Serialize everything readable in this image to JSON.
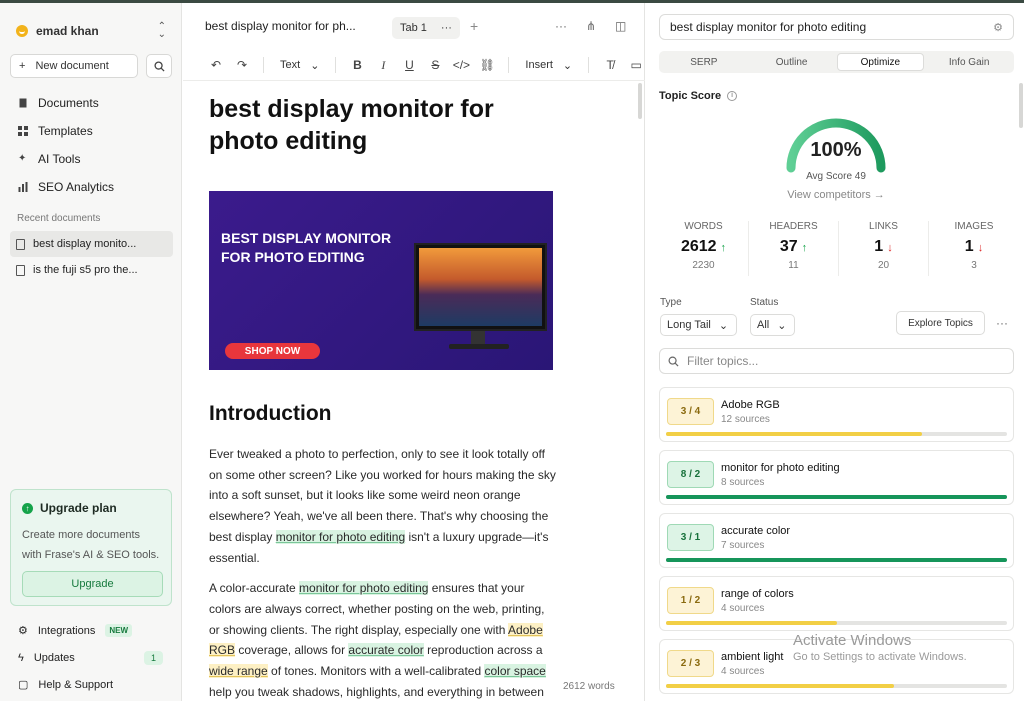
{
  "sidebar": {
    "user": "emad khan",
    "new_doc": "New document",
    "nav": [
      {
        "label": "Documents",
        "icon": "file-icon"
      },
      {
        "label": "Templates",
        "icon": "grid-icon"
      },
      {
        "label": "AI Tools",
        "icon": "sparkle-icon"
      },
      {
        "label": "SEO Analytics",
        "icon": "chart-icon"
      }
    ],
    "recent_heading": "Recent documents",
    "recent": [
      "best display monito...",
      "is the fuji s5 pro the..."
    ],
    "upgrade": {
      "title": "Upgrade plan",
      "desc": "Create more documents with Frase's AI & SEO tools.",
      "button": "Upgrade"
    },
    "bottom": {
      "integrations": "Integrations",
      "new_badge": "NEW",
      "updates": "Updates",
      "updates_count": "1",
      "help": "Help & Support"
    }
  },
  "editor": {
    "doc_title": "best display monitor for ph...",
    "tab": "Tab 1",
    "toolbar": {
      "text": "Text",
      "insert": "Insert"
    },
    "h1": "best display monitor for photo editing",
    "hero": {
      "text": "BEST DISPLAY MONITOR FOR PHOTO EDITING",
      "cta": "SHOP NOW"
    },
    "h2": "Introduction",
    "p1": {
      "a": "Ever tweaked a photo to perfection, only to see it look totally off on some other screen? Like you worked for hours making the sky into a soft sunset, but it looks like some weird neon orange elsewhere? Yeah, we've all been there. That's why choosing the best display ",
      "k1": "monitor for photo editing",
      "b": " isn't a luxury upgrade—it's essential."
    },
    "p2": {
      "a": "A color-accurate ",
      "k1": "monitor for photo editing",
      "b": " ensures that your colors are always correct, whether posting on the web, printing, or showing clients. The right display, especially one with ",
      "k2": "Adobe RGB",
      "c": " coverage, allows for ",
      "k3": "accurate color",
      "d": " reproduction across a ",
      "k4": "wide range",
      "e": " of tones. Monitors with a well-calibrated ",
      "k5": "color space",
      "f": " help you tweak shadows, highlights, and everything in between"
    },
    "word_count": "2612 words"
  },
  "panel": {
    "keyword": "best display monitor for photo editing",
    "tabs": [
      "SERP",
      "Outline",
      "Optimize",
      "Info Gain"
    ],
    "active_tab": "Optimize",
    "topic_score_label": "Topic Score",
    "score": "100%",
    "score_value": 100,
    "avg": "Avg Score 49",
    "view_competitors": "View competitors →",
    "stats": [
      {
        "label": "WORDS",
        "value": "2612",
        "trend": "up",
        "sub": "2230"
      },
      {
        "label": "HEADERS",
        "value": "37",
        "trend": "up",
        "sub": "11"
      },
      {
        "label": "LINKS",
        "value": "1",
        "trend": "down",
        "sub": "20"
      },
      {
        "label": "IMAGES",
        "value": "1",
        "trend": "down",
        "sub": "3"
      }
    ],
    "type_label": "Type",
    "type_value": "Long Tail",
    "status_label": "Status",
    "status_value": "All",
    "explore": "Explore Topics",
    "filter_placeholder": "Filter topics...",
    "topics": [
      {
        "count": "3 / 4",
        "name": "Adobe RGB",
        "sources": "12 sources",
        "progress": 0.75,
        "color": "#f2cf45",
        "style": "y"
      },
      {
        "count": "8 / 2",
        "name": "monitor for photo editing",
        "sources": "8 sources",
        "progress": 1.0,
        "color": "#16955a",
        "style": "g"
      },
      {
        "count": "3 / 1",
        "name": "accurate color",
        "sources": "7 sources",
        "progress": 1.0,
        "color": "#16955a",
        "style": "g"
      },
      {
        "count": "1 / 2",
        "name": "range of colors",
        "sources": "4 sources",
        "progress": 0.5,
        "color": "#f2cf45",
        "style": "y"
      },
      {
        "count": "2 / 3",
        "name": "ambient light",
        "sources": "4 sources",
        "progress": 0.67,
        "color": "#f2cf45",
        "style": "y"
      }
    ]
  },
  "watermark": {
    "line1": "Activate Windows",
    "line2": "Go to Settings to activate Windows."
  }
}
